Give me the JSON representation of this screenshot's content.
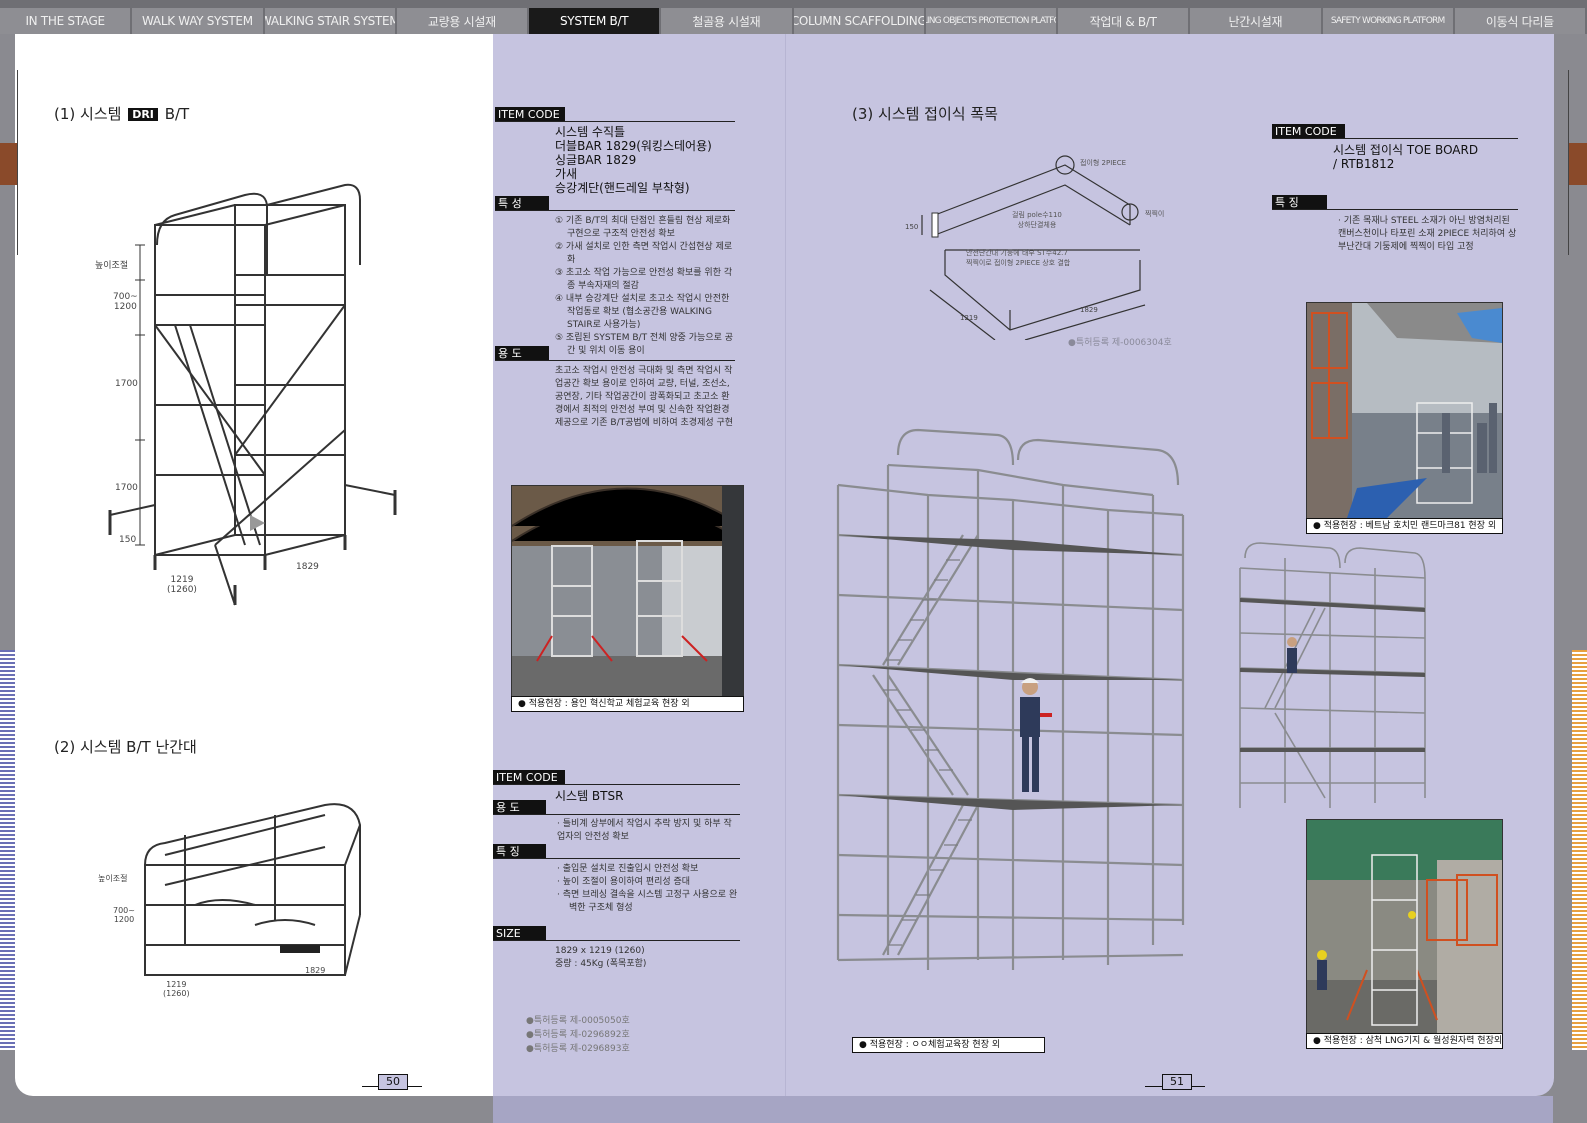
{
  "tabs": [
    {
      "label": "IN THE STAGE",
      "small": false
    },
    {
      "label": "WALK WAY SYSTEM",
      "small": false
    },
    {
      "label": "WALKING STAIR SYSTEM",
      "small": false
    },
    {
      "label": "교량용 시설재",
      "small": false
    },
    {
      "label": "SYSTEM B/T",
      "small": false,
      "active": true
    },
    {
      "label": "철골용 시설재",
      "small": false
    },
    {
      "label": "COLUMN SCAFFOLDING",
      "small": false
    },
    {
      "label": "FALLING OBJECTS PROTECTION PLATFORM",
      "small": true
    },
    {
      "label": "작업대 & B/T",
      "small": false
    },
    {
      "label": "난간시설재",
      "small": false
    },
    {
      "label": "SAFETY WORKING PLATFORM",
      "small": true
    },
    {
      "label": "이동식 다리들",
      "small": false
    }
  ],
  "left": {
    "section1": {
      "prefix": "(1) 시스템",
      "logo": "DRI",
      "suffix": "B/T"
    },
    "section1_dims": {
      "height_adj": "높이조절",
      "h1": "700~\n1200",
      "h2": "1700",
      "h3": "1700",
      "h4": "150",
      "w": "1219\n(1260)",
      "d": "1829"
    },
    "section2": {
      "title": "(2) 시스템 B/T 난간대"
    },
    "section2_dims": {
      "height_adj": "높이조절",
      "h": "700~\n1200",
      "w": "1219\n(1260)",
      "d": "1829"
    },
    "page_number": "50"
  },
  "mid": {
    "block1": {
      "item_code_label": "ITEM CODE",
      "items": "시스템 수직틀\n더블BAR 1829(워킹스테어용)\n싱글BAR 1829\n가새\n승강계단(핸드레일 부착형)",
      "features_label": "특 성",
      "features": [
        "① 기존 B/T의 최대 단점인 흔들림 현상 제로화 구현으로 구조적 안전성 확보",
        "② 가새 설치로 인한 측면 작업시 간섭현상 제로화",
        "③ 초고소 작업 가능으로 안전성 확보를 위한 각종 부속자재의 절감",
        "④ 내부 승강계단 설치로 초고소 작업시 안전한 작업동로 확보 (협소공간용 WALKING STAIR로 사용가능)",
        "⑤ 조립된 SYSTEM B/T 전체 양중 가능으로 공간 및 위치 이동 용이"
      ],
      "usage_label": "용 도",
      "usage": "초고소 작업시 안전성 극대화 및 측면 작업시 작업공간 확보 용이로 인하여 교량, 터널, 조선소, 공연장, 기타 작업공간이 광폭화되고 초고소 환경에서 최적의 안전성 부여 및 신속한 작업환경 제공으로 기존 B/T공법에 비하여 초경제성 구현",
      "photo_caption": "● 적용현장 : 용인 혁신학교 체험교육 현장 외"
    },
    "block2": {
      "item_code_label": "ITEM CODE",
      "item": "시스템 BTSR",
      "usage_label": "용 도",
      "usage": "· 틀비계 상부에서 작업시 추락 방지 및 하부 작업자의 안전성 확보",
      "features_label": "특 징",
      "features": [
        "· 출입문 설치로 진출입시 안전성 확보",
        "· 높이 조절이 용이하여 편리성 증대",
        "· 측면 브레싱 결속을 시스템 고정구 사용으로 완벽한 구조체 형성"
      ],
      "size_label": "SIZE",
      "size": "1829 x 1219 (1260)\n중량 : 45Kg (폭목포함)"
    },
    "patents": [
      "●특허등록 제-0005050호",
      "●특허등록 제-0296892호",
      "●특허등록 제-0296893호"
    ]
  },
  "right": {
    "section3": {
      "title": "(3) 시스템 접이식 폭목"
    },
    "toe_labels": {
      "fold": "접이형 2PIECE",
      "hook": "찍찍이",
      "pole": "걸림 pole수110\n상하단결체용",
      "desc": "안전난간대 기둥에 태부 ST수42.7\n찍찍이로 접이형 2PIECE 상호 결합",
      "h": "150",
      "w": "1219",
      "d": "1829"
    },
    "toe_patent": "●특허등록 제-0006304호",
    "spec": {
      "item_code_label": "ITEM CODE",
      "item": "시스템 접이식 TOE BOARD\n/ RTB1812",
      "features_label": "특 징",
      "features": "· 기존 목재나 STEEL 소재가 아닌 방염처리된 캔버스천이나 타포린 소재 2PIECE 처리하여 상부난간대 기둥제에 찍찍이 타입 고정"
    },
    "captions": {
      "main": "● 적용현장 : ㅇㅇ체험교육장 현장 외",
      "top": "● 적용현장 : 베트남 호치민 랜드마크81 현장 외",
      "bottom": "● 적용현장 : 삼척 LNG기지 & 월성원자력 현장외"
    },
    "page_number": "51"
  },
  "colors": {
    "lavender": "#c6c4e0",
    "label_black": "#111111",
    "tab_gray": "#8e8e93",
    "tab_active": "#1a1a1a"
  }
}
